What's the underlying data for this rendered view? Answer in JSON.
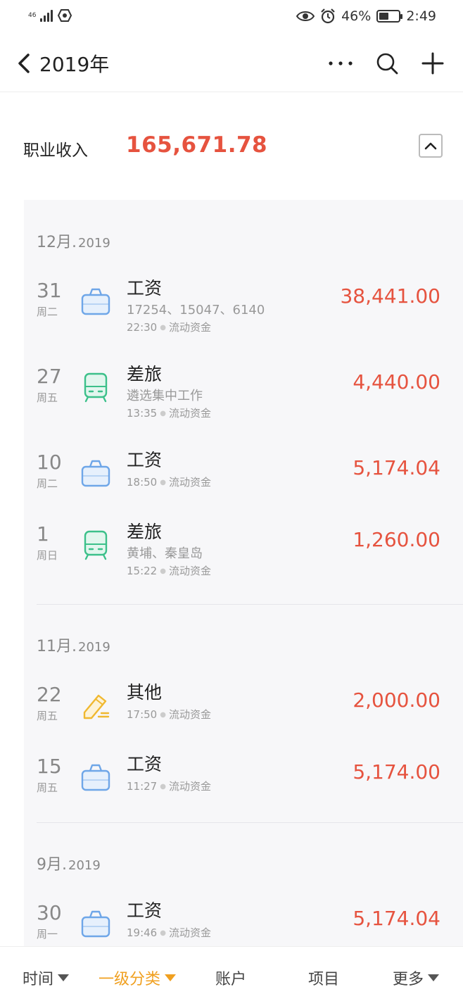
{
  "status_bar": {
    "network": "46",
    "battery": "46%",
    "time": "2:49"
  },
  "header": {
    "title": "2019年"
  },
  "summary": {
    "label": "职业收入",
    "total": "165,671.78"
  },
  "groups": [
    {
      "month": "12月.",
      "year": "2019",
      "items": [
        {
          "day": "31",
          "weekday": "周二",
          "icon": "briefcase-icon",
          "category": "工资",
          "note": "17254、15047、6140",
          "time": "22:30",
          "account": "流动资金",
          "amount": "38,441.00"
        },
        {
          "day": "27",
          "weekday": "周五",
          "icon": "train-icon",
          "category": "差旅",
          "note": "遴选集中工作",
          "time": "13:35",
          "account": "流动资金",
          "amount": "4,440.00"
        },
        {
          "day": "10",
          "weekday": "周二",
          "icon": "briefcase-icon",
          "category": "工资",
          "note": "",
          "time": "18:50",
          "account": "流动资金",
          "amount": "5,174.04"
        },
        {
          "day": "1",
          "weekday": "周日",
          "icon": "train-icon",
          "category": "差旅",
          "note": "黄埔、秦皇岛",
          "time": "15:22",
          "account": "流动资金",
          "amount": "1,260.00"
        }
      ]
    },
    {
      "month": "11月.",
      "year": "2019",
      "items": [
        {
          "day": "22",
          "weekday": "周五",
          "icon": "pencil-icon",
          "category": "其他",
          "note": "",
          "time": "17:50",
          "account": "流动资金",
          "amount": "2,000.00"
        },
        {
          "day": "15",
          "weekday": "周五",
          "icon": "briefcase-icon",
          "category": "工资",
          "note": "",
          "time": "11:27",
          "account": "流动资金",
          "amount": "5,174.00"
        }
      ]
    },
    {
      "month": "9月.",
      "year": "2019",
      "items": [
        {
          "day": "30",
          "weekday": "周一",
          "icon": "briefcase-icon",
          "category": "工资",
          "note": "",
          "time": "19:46",
          "account": "流动资金",
          "amount": "5,174.04"
        }
      ]
    }
  ],
  "bottom_nav": [
    {
      "label": "时间",
      "dropdown": true,
      "active": false
    },
    {
      "label": "一级分类",
      "dropdown": true,
      "active": true
    },
    {
      "label": "账户",
      "dropdown": false,
      "active": false
    },
    {
      "label": "项目",
      "dropdown": false,
      "active": false
    },
    {
      "label": "更多",
      "dropdown": true,
      "active": false
    }
  ],
  "colors": {
    "amount": "#e6533f",
    "active_tab": "#f0a020",
    "briefcase": "#6ea6e8",
    "train": "#3cc08a",
    "pencil": "#f0b830"
  }
}
